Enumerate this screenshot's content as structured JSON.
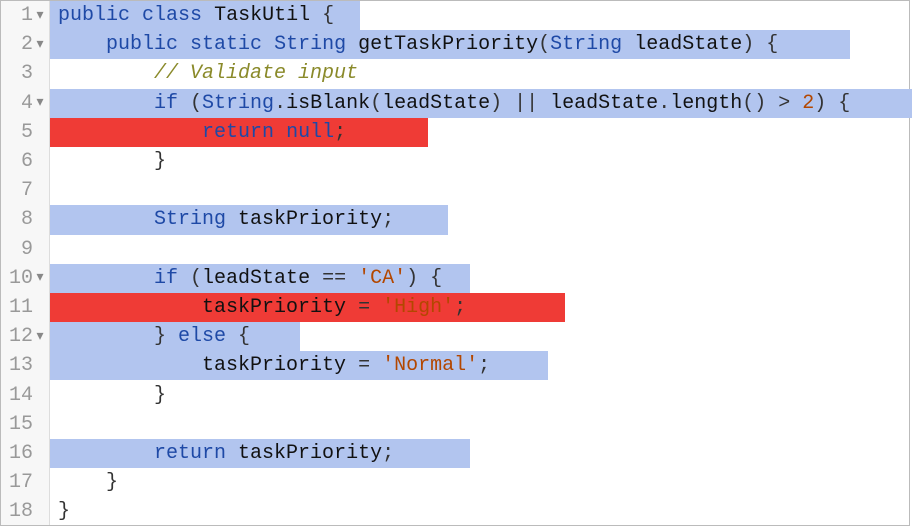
{
  "language": "apex",
  "gutter": [
    {
      "n": "1",
      "fold": true
    },
    {
      "n": "2",
      "fold": true
    },
    {
      "n": "3",
      "fold": false
    },
    {
      "n": "4",
      "fold": true
    },
    {
      "n": "5",
      "fold": false
    },
    {
      "n": "6",
      "fold": false
    },
    {
      "n": "7",
      "fold": false
    },
    {
      "n": "8",
      "fold": false
    },
    {
      "n": "9",
      "fold": false
    },
    {
      "n": "10",
      "fold": true
    },
    {
      "n": "11",
      "fold": false
    },
    {
      "n": "12",
      "fold": true
    },
    {
      "n": "13",
      "fold": false
    },
    {
      "n": "14",
      "fold": false
    },
    {
      "n": "15",
      "fold": false
    },
    {
      "n": "16",
      "fold": false
    },
    {
      "n": "17",
      "fold": false
    },
    {
      "n": "18",
      "fold": false
    }
  ],
  "fold_glyph": "▾",
  "highlights": [
    {
      "line": 1,
      "color": "blue",
      "from": 0,
      "to": 310
    },
    {
      "line": 2,
      "color": "blue",
      "from": 0,
      "to": 800
    },
    {
      "line": 4,
      "color": "blue",
      "from": 0,
      "to": 870
    },
    {
      "line": 5,
      "color": "red",
      "from": 0,
      "to": 378
    },
    {
      "line": 8,
      "color": "blue",
      "from": 0,
      "to": 398
    },
    {
      "line": 10,
      "color": "blue",
      "from": 0,
      "to": 420
    },
    {
      "line": 11,
      "color": "red",
      "from": 0,
      "to": 515
    },
    {
      "line": 12,
      "color": "blue",
      "from": 0,
      "to": 250
    },
    {
      "line": 13,
      "color": "blue",
      "from": 0,
      "to": 498
    },
    {
      "line": 16,
      "color": "blue",
      "from": 0,
      "to": 420
    }
  ],
  "tokens": {
    "l1": [
      [
        "kw",
        "public"
      ],
      [
        "pn",
        " "
      ],
      [
        "kw",
        "class"
      ],
      [
        "pn",
        " "
      ],
      [
        "id",
        "TaskUtil"
      ],
      [
        "pn",
        " {"
      ]
    ],
    "l2": [
      [
        "pn",
        "    "
      ],
      [
        "kw",
        "public"
      ],
      [
        "pn",
        " "
      ],
      [
        "kw",
        "static"
      ],
      [
        "pn",
        " "
      ],
      [
        "ty",
        "String"
      ],
      [
        "pn",
        " "
      ],
      [
        "fn",
        "getTaskPriority"
      ],
      [
        "pn",
        "("
      ],
      [
        "ty",
        "String"
      ],
      [
        "pn",
        " "
      ],
      [
        "id",
        "leadState"
      ],
      [
        "pn",
        ") {"
      ]
    ],
    "l3": [
      [
        "pn",
        "        "
      ],
      [
        "cm",
        "// Validate input"
      ]
    ],
    "l4": [
      [
        "pn",
        "        "
      ],
      [
        "kw",
        "if"
      ],
      [
        "pn",
        " ("
      ],
      [
        "ty",
        "String"
      ],
      [
        "pn",
        "."
      ],
      [
        "fn",
        "isBlank"
      ],
      [
        "pn",
        "("
      ],
      [
        "id",
        "leadState"
      ],
      [
        "pn",
        ") || "
      ],
      [
        "id",
        "leadState"
      ],
      [
        "pn",
        "."
      ],
      [
        "fn",
        "length"
      ],
      [
        "pn",
        "() > "
      ],
      [
        "nm",
        "2"
      ],
      [
        "pn",
        ") {"
      ]
    ],
    "l5": [
      [
        "pn",
        "            "
      ],
      [
        "kw",
        "return"
      ],
      [
        "pn",
        " "
      ],
      [
        "kw",
        "null"
      ],
      [
        "pn",
        ";"
      ]
    ],
    "l6": [
      [
        "pn",
        "        }"
      ]
    ],
    "l7": [
      [
        "pn",
        ""
      ]
    ],
    "l8": [
      [
        "pn",
        "        "
      ],
      [
        "ty",
        "String"
      ],
      [
        "pn",
        " "
      ],
      [
        "id",
        "taskPriority"
      ],
      [
        "pn",
        ";"
      ]
    ],
    "l9": [
      [
        "pn",
        ""
      ]
    ],
    "l10": [
      [
        "pn",
        "        "
      ],
      [
        "kw",
        "if"
      ],
      [
        "pn",
        " ("
      ],
      [
        "id",
        "leadState"
      ],
      [
        "pn",
        " == "
      ],
      [
        "st",
        "'CA'"
      ],
      [
        "pn",
        ") {"
      ]
    ],
    "l11": [
      [
        "pn",
        "            "
      ],
      [
        "id",
        "taskPriority"
      ],
      [
        "pn",
        " = "
      ],
      [
        "st",
        "'High'"
      ],
      [
        "pn",
        ";"
      ]
    ],
    "l12": [
      [
        "pn",
        "        } "
      ],
      [
        "kw",
        "else"
      ],
      [
        "pn",
        " {"
      ]
    ],
    "l13": [
      [
        "pn",
        "            "
      ],
      [
        "id",
        "taskPriority"
      ],
      [
        "pn",
        " = "
      ],
      [
        "st",
        "'Normal'"
      ],
      [
        "pn",
        ";"
      ]
    ],
    "l14": [
      [
        "pn",
        "        }"
      ]
    ],
    "l15": [
      [
        "pn",
        ""
      ]
    ],
    "l16": [
      [
        "pn",
        "        "
      ],
      [
        "kw",
        "return"
      ],
      [
        "pn",
        " "
      ],
      [
        "id",
        "taskPriority"
      ],
      [
        "pn",
        ";"
      ]
    ],
    "l17": [
      [
        "pn",
        "    }"
      ]
    ],
    "l18": [
      [
        "pn",
        "}"
      ]
    ]
  }
}
